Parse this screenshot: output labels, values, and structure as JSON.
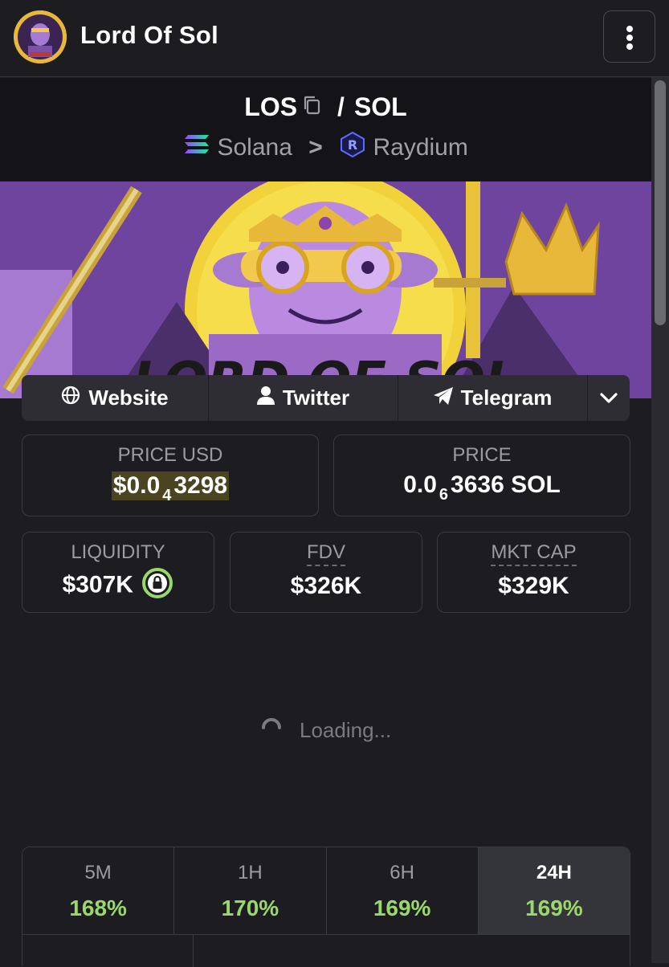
{
  "header": {
    "title": "Lord Of Sol",
    "logo_icon": "lord-of-sol-logo",
    "menu_icon": "more-vertical-icon"
  },
  "pair": {
    "base": "LOS",
    "quote": "SOL",
    "separator": "/",
    "chain": "Solana",
    "chain_arrow": ">",
    "dex": "Raydium"
  },
  "banner": {
    "text": "LORD OF SOL"
  },
  "links": {
    "website": "Website",
    "twitter": "Twitter",
    "telegram": "Telegram"
  },
  "stats": {
    "price_usd_label": "PRICE USD",
    "price_usd_prefix": "$0.0",
    "price_usd_zeros": "4",
    "price_usd_digits": "3298",
    "price_label": "PRICE",
    "price_prefix": "0.0",
    "price_zeros": "6",
    "price_digits": "3636 SOL",
    "liquidity_label": "LIQUIDITY",
    "liquidity_value": "$307K",
    "fdv_label": "FDV",
    "fdv_value": "$326K",
    "mktcap_label": "MKT CAP",
    "mktcap_value": "$329K"
  },
  "loading": {
    "text": "Loading..."
  },
  "timeframes": [
    {
      "label": "5M",
      "change": "168%",
      "active": false
    },
    {
      "label": "1H",
      "change": "170%",
      "active": false
    },
    {
      "label": "6H",
      "change": "169%",
      "active": false
    },
    {
      "label": "24H",
      "change": "169%",
      "active": true
    }
  ],
  "colors": {
    "background": "#1c1c21",
    "positive": "#9bd86b",
    "accent_lock": "#9bd86b",
    "highlight": "#4a4420"
  }
}
